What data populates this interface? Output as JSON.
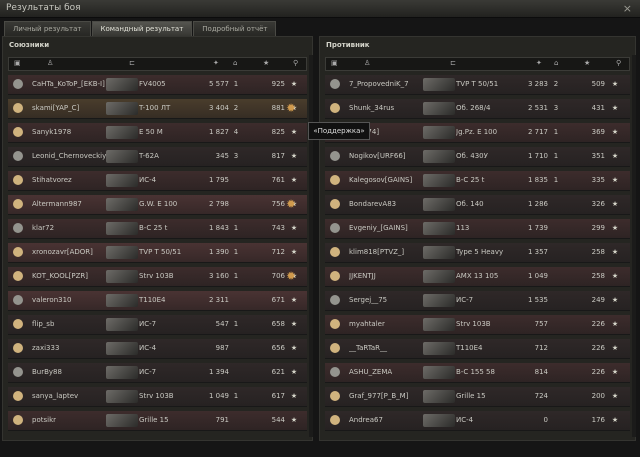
{
  "window": {
    "title": "Результаты боя",
    "close": "×"
  },
  "tabs": [
    {
      "label": "Личный результат"
    },
    {
      "label": "Командный результат"
    },
    {
      "label": "Подробный отчёт"
    }
  ],
  "allies": {
    "title": "Союзники",
    "rows": [
      {
        "name": "CaHTa_KoToP_[EKB-I]",
        "tank": "FV4005",
        "damage": "5 577",
        "kills": "1",
        "xp": "925"
      },
      {
        "name": "skami[YAP_C]",
        "tank": "T-100 ЛТ",
        "damage": "3 404",
        "kills": "2",
        "xp": "881"
      },
      {
        "name": "Sanyk1978",
        "tank": "E 50 M",
        "damage": "1 827",
        "kills": "4",
        "xp": "825"
      },
      {
        "name": "Leonid_Chernoveckiy",
        "tank": "T-62A",
        "damage": "345",
        "kills": "3",
        "xp": "817"
      },
      {
        "name": "Stihatvorez",
        "tank": "ИС-4",
        "damage": "1 795",
        "kills": "",
        "xp": "761"
      },
      {
        "name": "Altermann987",
        "tank": "G.W. E 100",
        "damage": "2 798",
        "kills": "",
        "xp": "756"
      },
      {
        "name": "klar72",
        "tank": "В-С 25 t",
        "damage": "1 843",
        "kills": "1",
        "xp": "743"
      },
      {
        "name": "xronozavr[ADOR]",
        "tank": "TVP T 50/51",
        "damage": "1 390",
        "kills": "1",
        "xp": "712"
      },
      {
        "name": "KOT_KOOL[PZR]",
        "tank": "Strv 103B",
        "damage": "3 160",
        "kills": "1",
        "xp": "706"
      },
      {
        "name": "valeron310",
        "tank": "T110E4",
        "damage": "2 311",
        "kills": "",
        "xp": "671"
      },
      {
        "name": "flip_sb",
        "tank": "ИС-7",
        "damage": "547",
        "kills": "1",
        "xp": "658"
      },
      {
        "name": "zaxi333",
        "tank": "ИС-4",
        "damage": "987",
        "kills": "",
        "xp": "656"
      },
      {
        "name": "BurBy88",
        "tank": "ИС-7",
        "damage": "1 394",
        "kills": "",
        "xp": "621"
      },
      {
        "name": "sanya_laptev",
        "tank": "Strv 103B",
        "damage": "1 049",
        "kills": "1",
        "xp": "617"
      },
      {
        "name": "potsikr",
        "tank": "Grille 15",
        "damage": "791",
        "kills": "",
        "xp": "544"
      }
    ]
  },
  "enemies": {
    "title": "Противник",
    "rows": [
      {
        "name": "7_PropovedniK_7",
        "tank": "TVP T 50/51",
        "damage": "3 283",
        "kills": "2",
        "xp": "509"
      },
      {
        "name": "Shunk_34rus",
        "tank": "Об. 268/4",
        "damage": "2 531",
        "kills": "3",
        "xp": "431"
      },
      {
        "name": "[EMN74]",
        "tank": "Jg.Pz. E 100",
        "damage": "2 717",
        "kills": "1",
        "xp": "369"
      },
      {
        "name": "Nogikov[URF66]",
        "tank": "Об. 430У",
        "damage": "1 710",
        "kills": "1",
        "xp": "351"
      },
      {
        "name": "Kalegosov[GAINS]",
        "tank": "В-С 25 t",
        "damage": "1 835",
        "kills": "1",
        "xp": "335"
      },
      {
        "name": "BondarevA83",
        "tank": "Об. 140",
        "damage": "1 286",
        "kills": "",
        "xp": "326"
      },
      {
        "name": "Evgeniy_[GAINS]",
        "tank": "113",
        "damage": "1 739",
        "kills": "",
        "xp": "299"
      },
      {
        "name": "klim818[PTVZ_]",
        "tank": "Type 5 Heavy",
        "damage": "1 357",
        "kills": "",
        "xp": "258"
      },
      {
        "name": "JJKENTJJ",
        "tank": "AMX 13 105",
        "damage": "1 049",
        "kills": "",
        "xp": "258"
      },
      {
        "name": "Sergej__75",
        "tank": "ИС-7",
        "damage": "1 535",
        "kills": "",
        "xp": "249"
      },
      {
        "name": "myahtaler",
        "tank": "Strv 103B",
        "damage": "757",
        "kills": "",
        "xp": "226"
      },
      {
        "name": "__TaRTaR__",
        "tank": "T110E4",
        "damage": "712",
        "kills": "",
        "xp": "226"
      },
      {
        "name": "ASHU_ZEMA",
        "tank": "В-С 155 58",
        "damage": "814",
        "kills": "",
        "xp": "226"
      },
      {
        "name": "Graf_977[P_B_M]",
        "tank": "Grille 15",
        "damage": "724",
        "kills": "",
        "xp": "200"
      },
      {
        "name": "Andrea67",
        "tank": "ИС-4",
        "damage": "0",
        "kills": "",
        "xp": "176"
      }
    ]
  },
  "tooltip": "«Поддержка»"
}
